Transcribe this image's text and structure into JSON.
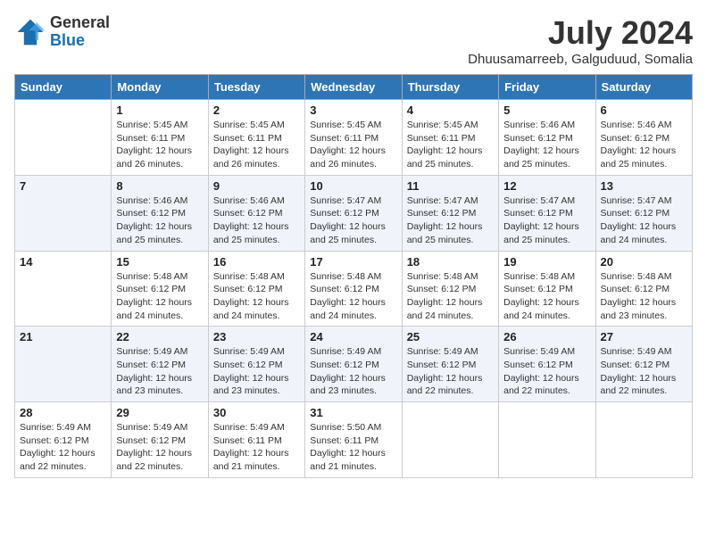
{
  "header": {
    "logo_general": "General",
    "logo_blue": "Blue",
    "month_title": "July 2024",
    "location": "Dhuusamarreeb, Galguduud, Somalia"
  },
  "columns": [
    "Sunday",
    "Monday",
    "Tuesday",
    "Wednesday",
    "Thursday",
    "Friday",
    "Saturday"
  ],
  "weeks": [
    [
      {
        "day": "",
        "info": ""
      },
      {
        "day": "1",
        "info": "Sunrise: 5:45 AM\nSunset: 6:11 PM\nDaylight: 12 hours\nand 26 minutes."
      },
      {
        "day": "2",
        "info": "Sunrise: 5:45 AM\nSunset: 6:11 PM\nDaylight: 12 hours\nand 26 minutes."
      },
      {
        "day": "3",
        "info": "Sunrise: 5:45 AM\nSunset: 6:11 PM\nDaylight: 12 hours\nand 26 minutes."
      },
      {
        "day": "4",
        "info": "Sunrise: 5:45 AM\nSunset: 6:11 PM\nDaylight: 12 hours\nand 25 minutes."
      },
      {
        "day": "5",
        "info": "Sunrise: 5:46 AM\nSunset: 6:12 PM\nDaylight: 12 hours\nand 25 minutes."
      },
      {
        "day": "6",
        "info": "Sunrise: 5:46 AM\nSunset: 6:12 PM\nDaylight: 12 hours\nand 25 minutes."
      }
    ],
    [
      {
        "day": "7",
        "info": ""
      },
      {
        "day": "8",
        "info": "Sunrise: 5:46 AM\nSunset: 6:12 PM\nDaylight: 12 hours\nand 25 minutes."
      },
      {
        "day": "9",
        "info": "Sunrise: 5:46 AM\nSunset: 6:12 PM\nDaylight: 12 hours\nand 25 minutes."
      },
      {
        "day": "10",
        "info": "Sunrise: 5:47 AM\nSunset: 6:12 PM\nDaylight: 12 hours\nand 25 minutes."
      },
      {
        "day": "11",
        "info": "Sunrise: 5:47 AM\nSunset: 6:12 PM\nDaylight: 12 hours\nand 25 minutes."
      },
      {
        "day": "12",
        "info": "Sunrise: 5:47 AM\nSunset: 6:12 PM\nDaylight: 12 hours\nand 25 minutes."
      },
      {
        "day": "13",
        "info": "Sunrise: 5:47 AM\nSunset: 6:12 PM\nDaylight: 12 hours\nand 24 minutes."
      }
    ],
    [
      {
        "day": "14",
        "info": ""
      },
      {
        "day": "15",
        "info": "Sunrise: 5:48 AM\nSunset: 6:12 PM\nDaylight: 12 hours\nand 24 minutes."
      },
      {
        "day": "16",
        "info": "Sunrise: 5:48 AM\nSunset: 6:12 PM\nDaylight: 12 hours\nand 24 minutes."
      },
      {
        "day": "17",
        "info": "Sunrise: 5:48 AM\nSunset: 6:12 PM\nDaylight: 12 hours\nand 24 minutes."
      },
      {
        "day": "18",
        "info": "Sunrise: 5:48 AM\nSunset: 6:12 PM\nDaylight: 12 hours\nand 24 minutes."
      },
      {
        "day": "19",
        "info": "Sunrise: 5:48 AM\nSunset: 6:12 PM\nDaylight: 12 hours\nand 24 minutes."
      },
      {
        "day": "20",
        "info": "Sunrise: 5:48 AM\nSunset: 6:12 PM\nDaylight: 12 hours\nand 23 minutes."
      }
    ],
    [
      {
        "day": "21",
        "info": ""
      },
      {
        "day": "22",
        "info": "Sunrise: 5:49 AM\nSunset: 6:12 PM\nDaylight: 12 hours\nand 23 minutes."
      },
      {
        "day": "23",
        "info": "Sunrise: 5:49 AM\nSunset: 6:12 PM\nDaylight: 12 hours\nand 23 minutes."
      },
      {
        "day": "24",
        "info": "Sunrise: 5:49 AM\nSunset: 6:12 PM\nDaylight: 12 hours\nand 23 minutes."
      },
      {
        "day": "25",
        "info": "Sunrise: 5:49 AM\nSunset: 6:12 PM\nDaylight: 12 hours\nand 22 minutes."
      },
      {
        "day": "26",
        "info": "Sunrise: 5:49 AM\nSunset: 6:12 PM\nDaylight: 12 hours\nand 22 minutes."
      },
      {
        "day": "27",
        "info": "Sunrise: 5:49 AM\nSunset: 6:12 PM\nDaylight: 12 hours\nand 22 minutes."
      }
    ],
    [
      {
        "day": "28",
        "info": "Sunrise: 5:49 AM\nSunset: 6:12 PM\nDaylight: 12 hours\nand 22 minutes."
      },
      {
        "day": "29",
        "info": "Sunrise: 5:49 AM\nSunset: 6:12 PM\nDaylight: 12 hours\nand 22 minutes."
      },
      {
        "day": "30",
        "info": "Sunrise: 5:49 AM\nSunset: 6:11 PM\nDaylight: 12 hours\nand 21 minutes."
      },
      {
        "day": "31",
        "info": "Sunrise: 5:50 AM\nSunset: 6:11 PM\nDaylight: 12 hours\nand 21 minutes."
      },
      {
        "day": "",
        "info": ""
      },
      {
        "day": "",
        "info": ""
      },
      {
        "day": "",
        "info": ""
      }
    ]
  ]
}
